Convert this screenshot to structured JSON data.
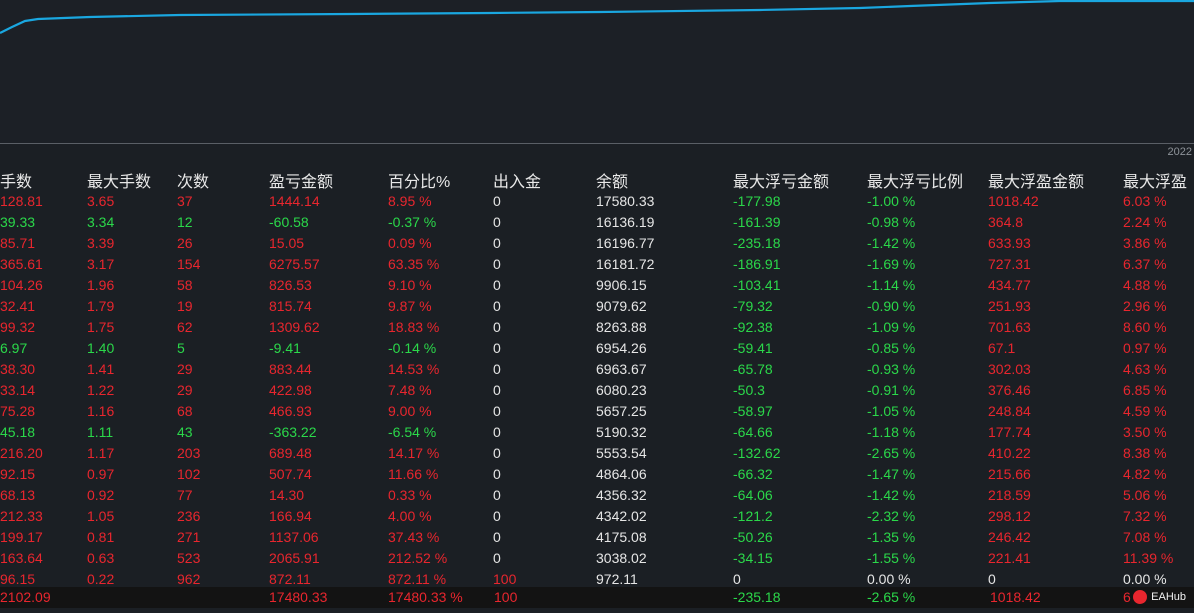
{
  "year_label": "2022",
  "headers": [
    "手数",
    "最大手数",
    "次数",
    "盈亏金额",
    "百分比%",
    "出入金",
    "余额",
    "最大浮亏金额",
    "最大浮亏比例",
    "最大浮盈金额",
    "最大浮盈"
  ],
  "rows": [
    [
      "128.81",
      "3.65",
      "37",
      "1444.14",
      "8.95 %",
      "0",
      "17580.33",
      "-177.98",
      "-1.00 %",
      "1018.42",
      "6.03 %"
    ],
    [
      "39.33",
      "3.34",
      "12",
      "-60.58",
      "-0.37 %",
      "0",
      "16136.19",
      "-161.39",
      "-0.98 %",
      "364.8",
      "2.24 %"
    ],
    [
      "85.71",
      "3.39",
      "26",
      "15.05",
      "0.09 %",
      "0",
      "16196.77",
      "-235.18",
      "-1.42 %",
      "633.93",
      "3.86 %"
    ],
    [
      "365.61",
      "3.17",
      "154",
      "6275.57",
      "63.35 %",
      "0",
      "16181.72",
      "-186.91",
      "-1.69 %",
      "727.31",
      "6.37 %"
    ],
    [
      "104.26",
      "1.96",
      "58",
      "826.53",
      "9.10 %",
      "0",
      "9906.15",
      "-103.41",
      "-1.14 %",
      "434.77",
      "4.88 %"
    ],
    [
      "32.41",
      "1.79",
      "19",
      "815.74",
      "9.87 %",
      "0",
      "9079.62",
      "-79.32",
      "-0.90 %",
      "251.93",
      "2.96 %"
    ],
    [
      "99.32",
      "1.75",
      "62",
      "1309.62",
      "18.83 %",
      "0",
      "8263.88",
      "-92.38",
      "-1.09 %",
      "701.63",
      "8.60 %"
    ],
    [
      "6.97",
      "1.40",
      "5",
      "-9.41",
      "-0.14 %",
      "0",
      "6954.26",
      "-59.41",
      "-0.85 %",
      "67.1",
      "0.97 %"
    ],
    [
      "38.30",
      "1.41",
      "29",
      "883.44",
      "14.53 %",
      "0",
      "6963.67",
      "-65.78",
      "-0.93 %",
      "302.03",
      "4.63 %"
    ],
    [
      "33.14",
      "1.22",
      "29",
      "422.98",
      "7.48 %",
      "0",
      "6080.23",
      "-50.3",
      "-0.91 %",
      "376.46",
      "6.85 %"
    ],
    [
      "75.28",
      "1.16",
      "68",
      "466.93",
      "9.00 %",
      "0",
      "5657.25",
      "-58.97",
      "-1.05 %",
      "248.84",
      "4.59 %"
    ],
    [
      "45.18",
      "1.11",
      "43",
      "-363.22",
      "-6.54 %",
      "0",
      "5190.32",
      "-64.66",
      "-1.18 %",
      "177.74",
      "3.50 %"
    ],
    [
      "216.20",
      "1.17",
      "203",
      "689.48",
      "14.17 %",
      "0",
      "5553.54",
      "-132.62",
      "-2.65 %",
      "410.22",
      "8.38 %"
    ],
    [
      "92.15",
      "0.97",
      "102",
      "507.74",
      "11.66 %",
      "0",
      "4864.06",
      "-66.32",
      "-1.47 %",
      "215.66",
      "4.82 %"
    ],
    [
      "68.13",
      "0.92",
      "77",
      "14.30",
      "0.33 %",
      "0",
      "4356.32",
      "-64.06",
      "-1.42 %",
      "218.59",
      "5.06 %"
    ],
    [
      "212.33",
      "1.05",
      "236",
      "166.94",
      "4.00 %",
      "0",
      "4342.02",
      "-121.2",
      "-2.32 %",
      "298.12",
      "7.32 %"
    ],
    [
      "199.17",
      "0.81",
      "271",
      "1137.06",
      "37.43 %",
      "0",
      "4175.08",
      "-50.26",
      "-1.35 %",
      "246.42",
      "7.08 %"
    ],
    [
      "163.64",
      "0.63",
      "523",
      "2065.91",
      "212.52 %",
      "0",
      "3038.02",
      "-34.15",
      "-1.55 %",
      "221.41",
      "11.39 %"
    ],
    [
      "96.15",
      "0.22",
      "962",
      "872.11",
      "872.11 %",
      "100",
      "972.11",
      "0",
      "0.00 %",
      "0",
      "0.00 %"
    ]
  ],
  "row_colors": [
    [
      "r",
      "r",
      "r",
      "r",
      "r",
      "w",
      "w",
      "g",
      "g",
      "r",
      "r"
    ],
    [
      "g",
      "g",
      "g",
      "g",
      "g",
      "w",
      "w",
      "g",
      "g",
      "r",
      "r"
    ],
    [
      "r",
      "r",
      "r",
      "r",
      "r",
      "w",
      "w",
      "g",
      "g",
      "r",
      "r"
    ],
    [
      "r",
      "r",
      "r",
      "r",
      "r",
      "w",
      "w",
      "g",
      "g",
      "r",
      "r"
    ],
    [
      "r",
      "r",
      "r",
      "r",
      "r",
      "w",
      "w",
      "g",
      "g",
      "r",
      "r"
    ],
    [
      "r",
      "r",
      "r",
      "r",
      "r",
      "w",
      "w",
      "g",
      "g",
      "r",
      "r"
    ],
    [
      "r",
      "r",
      "r",
      "r",
      "r",
      "w",
      "w",
      "g",
      "g",
      "r",
      "r"
    ],
    [
      "g",
      "g",
      "g",
      "g",
      "g",
      "w",
      "w",
      "g",
      "g",
      "r",
      "r"
    ],
    [
      "r",
      "r",
      "r",
      "r",
      "r",
      "w",
      "w",
      "g",
      "g",
      "r",
      "r"
    ],
    [
      "r",
      "r",
      "r",
      "r",
      "r",
      "w",
      "w",
      "g",
      "g",
      "r",
      "r"
    ],
    [
      "r",
      "r",
      "r",
      "r",
      "r",
      "w",
      "w",
      "g",
      "g",
      "r",
      "r"
    ],
    [
      "g",
      "g",
      "g",
      "g",
      "g",
      "w",
      "w",
      "g",
      "g",
      "r",
      "r"
    ],
    [
      "r",
      "r",
      "r",
      "r",
      "r",
      "w",
      "w",
      "g",
      "g",
      "r",
      "r"
    ],
    [
      "r",
      "r",
      "r",
      "r",
      "r",
      "w",
      "w",
      "g",
      "g",
      "r",
      "r"
    ],
    [
      "r",
      "r",
      "r",
      "r",
      "r",
      "w",
      "w",
      "g",
      "g",
      "r",
      "r"
    ],
    [
      "r",
      "r",
      "r",
      "r",
      "r",
      "w",
      "w",
      "g",
      "g",
      "r",
      "r"
    ],
    [
      "r",
      "r",
      "r",
      "r",
      "r",
      "w",
      "w",
      "g",
      "g",
      "r",
      "r"
    ],
    [
      "r",
      "r",
      "r",
      "r",
      "r",
      "w",
      "w",
      "g",
      "g",
      "r",
      "r"
    ],
    [
      "r",
      "r",
      "r",
      "r",
      "r",
      "r",
      "w",
      "w",
      "w",
      "w",
      "w"
    ]
  ],
  "total_row": {
    "lots": "2102.09",
    "profit": "17480.33",
    "percent": "17480.33 %",
    "deposit": "100",
    "max_float_loss": "-235.18",
    "max_float_loss_pct": "-2.65 %",
    "max_float_profit": "1018.42",
    "max_float_profit_pct": "6"
  },
  "logo_text": "EAHub",
  "colors": {
    "red": "#e8262e",
    "green": "#2bd84a",
    "white": "#e6e6e6",
    "curve": "#1aa7e0"
  }
}
